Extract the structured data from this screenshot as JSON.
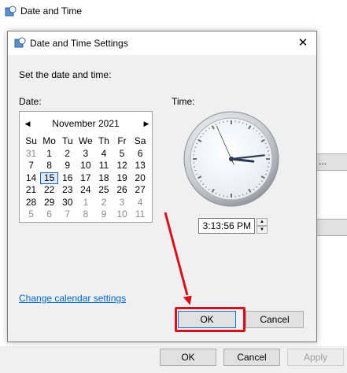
{
  "parent_window": {
    "title": "Date and Time",
    "side_button_text": "...",
    "buttons": {
      "ok": "OK",
      "cancel": "Cancel",
      "apply": "Apply"
    }
  },
  "dialog": {
    "title": "Date and Time Settings",
    "instruction": "Set the date and time:",
    "date_label": "Date:",
    "time_label": "Time:",
    "calendar": {
      "month_year": "November 2021",
      "weekdays": [
        "Su",
        "Mo",
        "Tu",
        "We",
        "Th",
        "Fr",
        "Sa"
      ],
      "weeks": [
        [
          "31",
          "1",
          "2",
          "3",
          "4",
          "5",
          "6"
        ],
        [
          "7",
          "8",
          "9",
          "10",
          "11",
          "12",
          "13"
        ],
        [
          "14",
          "15",
          "16",
          "17",
          "18",
          "19",
          "20"
        ],
        [
          "21",
          "22",
          "23",
          "24",
          "25",
          "26",
          "27"
        ],
        [
          "28",
          "29",
          "30",
          "1",
          "2",
          "3",
          "4"
        ],
        [
          "5",
          "6",
          "7",
          "8",
          "9",
          "10",
          "11"
        ]
      ],
      "selected_day": "15"
    },
    "clock": {
      "hours": 3,
      "minutes": 13,
      "seconds": 56
    },
    "time_value": "3:13:56 PM",
    "change_calendar_link": "Change calendar settings",
    "buttons": {
      "ok": "OK",
      "cancel": "Cancel"
    }
  },
  "colors": {
    "highlight": "#d8101c",
    "link": "#0066cc",
    "selection": "#1a5fb4"
  }
}
